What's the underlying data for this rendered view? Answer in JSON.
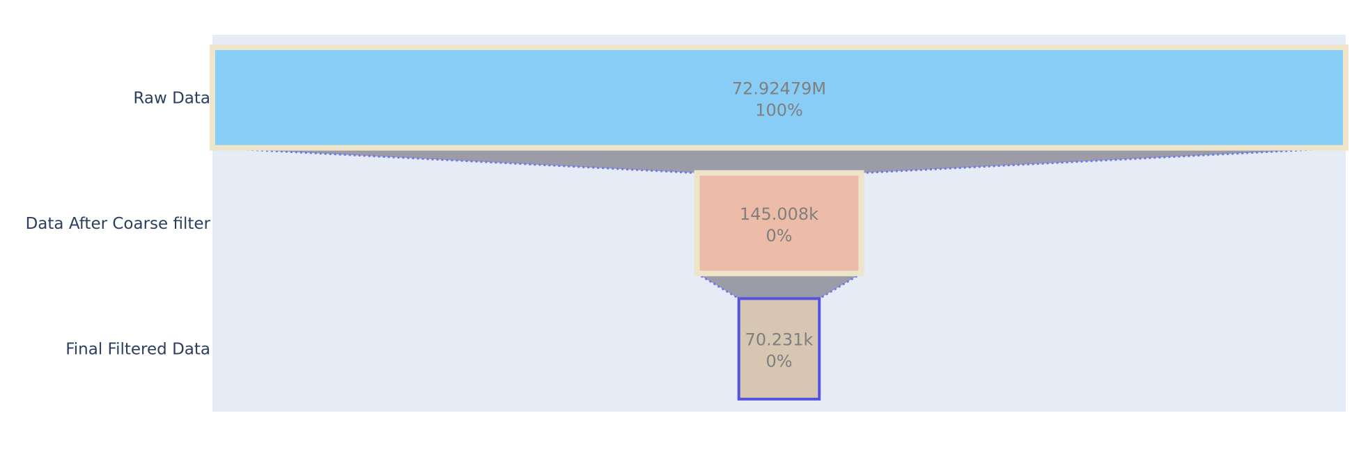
{
  "chart_data": {
    "type": "funnel",
    "categories": [
      "Raw Data",
      "Data After Coarse filter",
      "Final Filtered Data"
    ],
    "values": [
      72924790,
      145008,
      70231
    ],
    "value_labels": [
      "72.92479M",
      "145.008k",
      "70.231k"
    ],
    "percent_labels": [
      "100%",
      "0%",
      "0%"
    ],
    "colors": {
      "plot_background": "#e5ecf6",
      "stages": [
        "#87cdf5",
        "#edbca9",
        "#d6c6b2"
      ],
      "stage_outlines": [
        "#ede4ca",
        "#ede4ca",
        "#5454e0"
      ],
      "connector_fill": "#9b9ca8",
      "connector_line": "#6f78ee",
      "category_label": "#2a3f5f",
      "value_text": "#7f7f7f"
    }
  }
}
